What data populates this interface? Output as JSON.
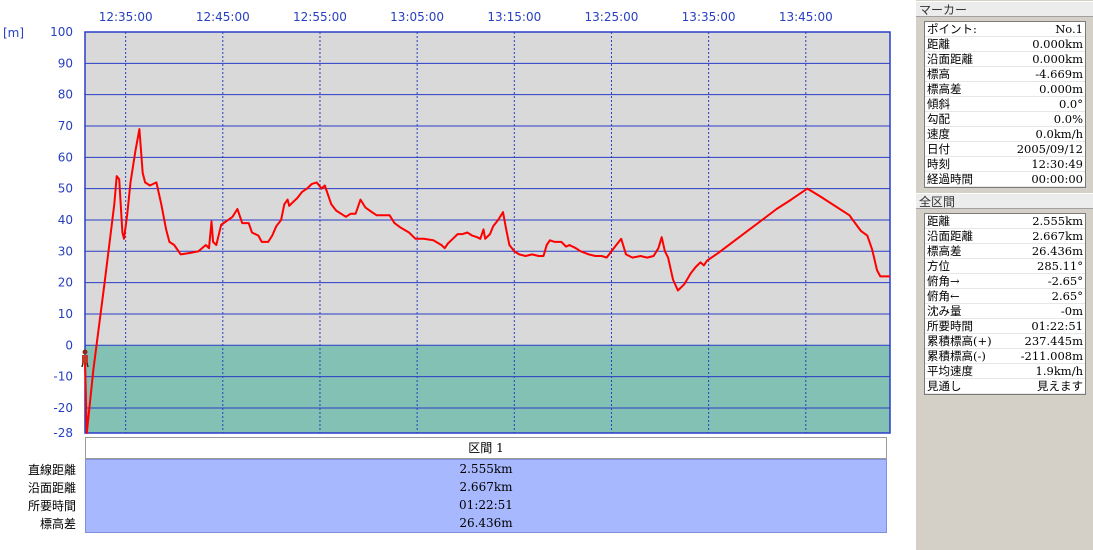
{
  "chart_data": {
    "type": "area",
    "y_unit_label": "[m]",
    "ylim": [
      -28,
      100
    ],
    "yticks": [
      100,
      90,
      80,
      70,
      60,
      50,
      40,
      30,
      20,
      10,
      0,
      -10,
      -20,
      -28
    ],
    "xticks": [
      "12:35:00",
      "12:45:00",
      "12:55:00",
      "13:05:00",
      "13:15:00",
      "13:25:00",
      "13:35:00",
      "13:45:00"
    ],
    "xlim": [
      "12:30:49",
      "13:53:40"
    ],
    "water_level": 0,
    "grid": true,
    "colors": {
      "line": "#ff0000",
      "sky": "#d9d9d9",
      "water": "#84c1b5",
      "grid": "#2a3dc8",
      "axis_text": "#2840c0"
    },
    "series": [
      {
        "points": [
          [
            "12:30:49",
            -4.7
          ],
          [
            "12:31:00",
            -28
          ],
          [
            "12:31:40",
            -8
          ],
          [
            "12:32:50",
            20
          ],
          [
            "12:33:50",
            45
          ],
          [
            "12:34:05",
            54
          ],
          [
            "12:34:20",
            53
          ],
          [
            "12:34:40",
            36
          ],
          [
            "12:34:50",
            34
          ],
          [
            "12:35:10",
            42
          ],
          [
            "12:35:30",
            52
          ],
          [
            "12:36:00",
            62
          ],
          [
            "12:36:25",
            69
          ],
          [
            "12:36:45",
            55
          ],
          [
            "12:37:00",
            52
          ],
          [
            "12:37:30",
            51
          ],
          [
            "12:38:10",
            52
          ],
          [
            "12:38:40",
            45
          ],
          [
            "12:39:10",
            37
          ],
          [
            "12:39:30",
            33
          ],
          [
            "12:40:00",
            32
          ],
          [
            "12:40:40",
            29
          ],
          [
            "12:41:40",
            29.5
          ],
          [
            "12:42:30",
            30
          ],
          [
            "12:43:15",
            32
          ],
          [
            "12:43:35",
            31
          ],
          [
            "12:43:50",
            39.5
          ],
          [
            "12:44:00",
            33
          ],
          [
            "12:44:20",
            32
          ],
          [
            "12:44:50",
            38.5
          ],
          [
            "12:45:20",
            39.5
          ],
          [
            "12:46:00",
            41
          ],
          [
            "12:46:30",
            43.5
          ],
          [
            "12:47:00",
            39
          ],
          [
            "12:47:40",
            39
          ],
          [
            "12:48:00",
            36
          ],
          [
            "12:48:40",
            35
          ],
          [
            "12:49:00",
            33
          ],
          [
            "12:49:40",
            33
          ],
          [
            "12:50:05",
            35
          ],
          [
            "12:50:30",
            38
          ],
          [
            "12:51:00",
            40
          ],
          [
            "12:51:20",
            45
          ],
          [
            "12:51:40",
            46.5
          ],
          [
            "12:51:50",
            44.5
          ],
          [
            "12:52:10",
            45.5
          ],
          [
            "12:52:40",
            47
          ],
          [
            "12:53:10",
            49
          ],
          [
            "12:53:40",
            50
          ],
          [
            "12:54:10",
            51.5
          ],
          [
            "12:54:40",
            52
          ],
          [
            "12:55:10",
            50
          ],
          [
            "12:55:30",
            51
          ],
          [
            "12:56:10",
            45
          ],
          [
            "12:56:40",
            43
          ],
          [
            "12:57:10",
            42
          ],
          [
            "12:57:40",
            41
          ],
          [
            "12:58:10",
            42
          ],
          [
            "12:58:40",
            42
          ],
          [
            "12:59:10",
            46.5
          ],
          [
            "12:59:40",
            44
          ],
          [
            "13:00:20",
            42.5
          ],
          [
            "13:00:50",
            41.5
          ],
          [
            "13:01:20",
            41.5
          ],
          [
            "13:02:10",
            41.5
          ],
          [
            "13:02:40",
            39
          ],
          [
            "13:03:20",
            37.5
          ],
          [
            "13:04:10",
            36
          ],
          [
            "13:04:50",
            34
          ],
          [
            "13:05:40",
            34
          ],
          [
            "13:06:40",
            33.5
          ],
          [
            "13:07:30",
            32
          ],
          [
            "13:07:50",
            31
          ],
          [
            "13:08:10",
            32.5
          ],
          [
            "13:08:40",
            34
          ],
          [
            "13:09:10",
            35.5
          ],
          [
            "13:09:40",
            35.5
          ],
          [
            "13:10:10",
            36
          ],
          [
            "13:10:40",
            35
          ],
          [
            "13:11:10",
            34.5
          ],
          [
            "13:11:30",
            34
          ],
          [
            "13:11:50",
            37
          ],
          [
            "13:12:00",
            34
          ],
          [
            "13:12:30",
            35.5
          ],
          [
            "13:12:50",
            38
          ],
          [
            "13:13:20",
            40
          ],
          [
            "13:13:50",
            42.5
          ],
          [
            "13:14:10",
            37
          ],
          [
            "13:14:30",
            32
          ],
          [
            "13:15:00",
            30
          ],
          [
            "13:15:30",
            29
          ],
          [
            "13:16:10",
            28.5
          ],
          [
            "13:16:50",
            29
          ],
          [
            "13:17:30",
            28.5
          ],
          [
            "13:18:00",
            28.5
          ],
          [
            "13:18:20",
            32
          ],
          [
            "13:18:40",
            33.5
          ],
          [
            "13:19:10",
            33
          ],
          [
            "13:19:50",
            33
          ],
          [
            "13:20:20",
            31.5
          ],
          [
            "13:20:40",
            32
          ],
          [
            "13:21:20",
            31
          ],
          [
            "13:21:50",
            30
          ],
          [
            "13:22:40",
            29
          ],
          [
            "13:23:20",
            28.5
          ],
          [
            "13:24:00",
            28.5
          ],
          [
            "13:24:30",
            28
          ],
          [
            "13:25:00",
            30
          ],
          [
            "13:25:30",
            32
          ],
          [
            "13:26:00",
            34
          ],
          [
            "13:26:30",
            29
          ],
          [
            "13:27:10",
            28
          ],
          [
            "13:28:00",
            28.5
          ],
          [
            "13:28:40",
            28
          ],
          [
            "13:29:20",
            28.5
          ],
          [
            "13:29:50",
            31
          ],
          [
            "13:30:10",
            34.5
          ],
          [
            "13:30:30",
            30
          ],
          [
            "13:30:50",
            28
          ],
          [
            "13:31:20",
            21
          ],
          [
            "13:31:50",
            17.5
          ],
          [
            "13:32:30",
            19.5
          ],
          [
            "13:33:10",
            23
          ],
          [
            "13:33:40",
            25
          ],
          [
            "13:34:10",
            26.5
          ],
          [
            "13:34:30",
            25.5
          ],
          [
            "13:34:50",
            27
          ],
          [
            "13:36:00",
            29.5
          ],
          [
            "13:37:30",
            33
          ],
          [
            "13:39:00",
            36.5
          ],
          [
            "13:40:30",
            40
          ],
          [
            "13:42:00",
            43.5
          ],
          [
            "13:43:30",
            46.5
          ],
          [
            "13:45:10",
            50
          ],
          [
            "13:46:30",
            47.5
          ],
          [
            "13:48:00",
            44.5
          ],
          [
            "13:49:30",
            41.5
          ],
          [
            "13:49:50",
            40
          ],
          [
            "13:50:40",
            36.5
          ],
          [
            "13:51:20",
            35
          ],
          [
            "13:51:50",
            30.5
          ],
          [
            "13:52:20",
            24
          ],
          [
            "13:52:40",
            22
          ],
          [
            "13:53:10",
            22
          ],
          [
            "13:53:40",
            22
          ]
        ]
      }
    ]
  },
  "segment": {
    "header": "区間 1",
    "labels": [
      "直線距離",
      "沿面距離",
      "所要時間",
      "標高差"
    ],
    "values": [
      "2.555km",
      "2.667km",
      "01:22:51",
      "26.436m"
    ]
  },
  "marker": {
    "title": "マーカー",
    "rows": [
      {
        "label": "ポイント:",
        "value": "No.1"
      },
      {
        "label": "距離",
        "value": "0.000km"
      },
      {
        "label": "沿面距離",
        "value": "0.000km"
      },
      {
        "label": "標高",
        "value": "-4.669m"
      },
      {
        "label": "標高差",
        "value": "0.000m"
      },
      {
        "label": "傾斜",
        "value": "0.0°"
      },
      {
        "label": "勾配",
        "value": "0.0%"
      },
      {
        "label": "速度",
        "value": "0.0km/h"
      },
      {
        "label": "日付",
        "value": "2005/09/12"
      },
      {
        "label": "時刻",
        "value": "12:30:49"
      },
      {
        "label": "経過時間",
        "value": "00:00:00"
      }
    ]
  },
  "summary": {
    "title": "全区間",
    "rows": [
      {
        "label": "距離",
        "value": "2.555km"
      },
      {
        "label": "沿面距離",
        "value": "2.667km"
      },
      {
        "label": "標高差",
        "value": "26.436m"
      },
      {
        "label": "方位",
        "value": "285.11°"
      },
      {
        "label": "俯角→",
        "value": "-2.65°"
      },
      {
        "label": "俯角←",
        "value": "2.65°"
      },
      {
        "label": "沈み量",
        "value": "-0m"
      },
      {
        "label": "所要時間",
        "value": "01:22:51"
      },
      {
        "label": "累積標高(+)",
        "value": "237.445m"
      },
      {
        "label": "累積標高(-)",
        "value": "-211.008m"
      },
      {
        "label": "平均速度",
        "value": "1.9km/h"
      },
      {
        "label": "見通し",
        "value": "見えます"
      }
    ]
  }
}
